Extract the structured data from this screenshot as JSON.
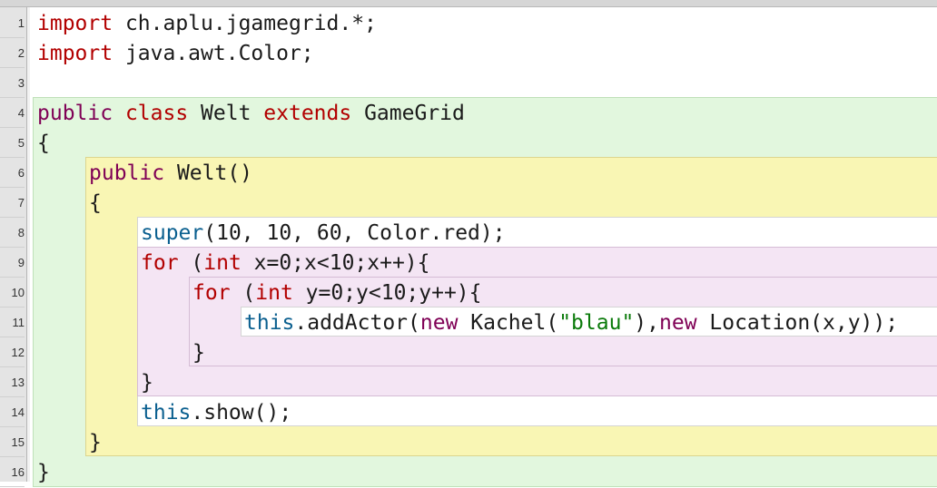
{
  "editor": {
    "line_numbers": [
      "1",
      "2",
      "3",
      "4",
      "5",
      "6",
      "7",
      "8",
      "9",
      "10",
      "11",
      "12",
      "13",
      "14",
      "15",
      "16"
    ],
    "lines": [
      {
        "num": "1",
        "tokens": [
          {
            "t": "import",
            "c": "kw"
          },
          {
            "t": " ch.aplu.jgamegrid.*;",
            "c": "plain"
          }
        ]
      },
      {
        "num": "2",
        "tokens": [
          {
            "t": "import",
            "c": "kw"
          },
          {
            "t": " java.awt.Color;",
            "c": "plain"
          }
        ]
      },
      {
        "num": "3",
        "tokens": []
      },
      {
        "num": "4",
        "tokens": [
          {
            "t": "public",
            "c": "kw2"
          },
          {
            "t": " ",
            "c": "plain"
          },
          {
            "t": "class",
            "c": "kw"
          },
          {
            "t": " Welt ",
            "c": "plain"
          },
          {
            "t": "extends",
            "c": "kw"
          },
          {
            "t": " GameGrid",
            "c": "plain"
          }
        ]
      },
      {
        "num": "5",
        "tokens": [
          {
            "t": "{",
            "c": "plain"
          }
        ]
      },
      {
        "num": "6",
        "tokens": [
          {
            "t": "public",
            "c": "kw2"
          },
          {
            "t": " Welt()",
            "c": "plain"
          }
        ]
      },
      {
        "num": "7",
        "tokens": [
          {
            "t": "{",
            "c": "plain"
          }
        ]
      },
      {
        "num": "8",
        "tokens": [
          {
            "t": "super",
            "c": "kw3"
          },
          {
            "t": "(10, 10, 60, Color.red);",
            "c": "plain"
          }
        ]
      },
      {
        "num": "9",
        "tokens": [
          {
            "t": "for",
            "c": "kw"
          },
          {
            "t": " (",
            "c": "plain"
          },
          {
            "t": "int",
            "c": "kw"
          },
          {
            "t": " x=0;x<10;x++){",
            "c": "plain"
          }
        ]
      },
      {
        "num": "10",
        "tokens": [
          {
            "t": "for",
            "c": "kw"
          },
          {
            "t": " (",
            "c": "plain"
          },
          {
            "t": "int",
            "c": "kw"
          },
          {
            "t": " y=0;y<10;y++){",
            "c": "plain"
          }
        ]
      },
      {
        "num": "11",
        "tokens": [
          {
            "t": "this",
            "c": "kw3"
          },
          {
            "t": ".addActor(",
            "c": "plain"
          },
          {
            "t": "new",
            "c": "kw2"
          },
          {
            "t": " Kachel(",
            "c": "plain"
          },
          {
            "t": "\"blau\"",
            "c": "str"
          },
          {
            "t": "),",
            "c": "plain"
          },
          {
            "t": "new",
            "c": "kw2"
          },
          {
            "t": " Location(x,y));",
            "c": "plain"
          }
        ]
      },
      {
        "num": "12",
        "tokens": [
          {
            "t": "}",
            "c": "plain"
          }
        ]
      },
      {
        "num": "13",
        "tokens": [
          {
            "t": "}",
            "c": "plain"
          }
        ]
      },
      {
        "num": "14",
        "tokens": [
          {
            "t": "this",
            "c": "kw3"
          },
          {
            "t": ".show();",
            "c": "plain"
          }
        ]
      },
      {
        "num": "15",
        "tokens": [
          {
            "t": "}",
            "c": "plain"
          }
        ]
      },
      {
        "num": "16",
        "tokens": [
          {
            "t": "}",
            "c": "plain"
          }
        ]
      }
    ]
  }
}
